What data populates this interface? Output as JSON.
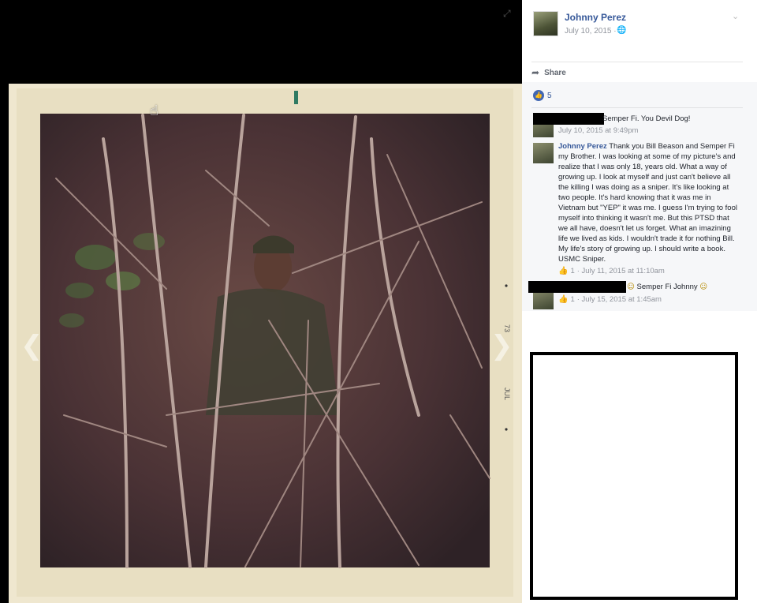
{
  "post": {
    "author": "Johnny Perez",
    "date": "July 10, 2015 ·",
    "globe_icon": "globe-icon",
    "share_label": "Share",
    "likes_count": "5"
  },
  "photo": {
    "edge_text_1": "73",
    "edge_text_2": "JUL"
  },
  "comments": [
    {
      "text": "Semper Fi. You Devil Dog!",
      "meta": "July 10, 2015 at 9:49pm"
    },
    {
      "author": "Johnny Perez",
      "text": "Thank you Bill Beason and Semper Fi my Brother. I was looking at some of my picture's and realize that I was only 18, years old. What a way of growing up. I look at myself and just can't believe all the killing I was doing as a sniper. It's like looking at two people. It's hard knowing that it was me in Vietnam but \"YEP\" it was me. I guess I'm trying to fool myself into thinking it wasn't me. But this PTSD that we all have, doesn't let us forget. What an imazining life we lived as kids. I wouldn't trade it for nothing Bill. My life's story of growing up. I should write a book. USMC Sniper.",
      "like_count": "1",
      "meta": "· July 11, 2015 at 11:10am"
    },
    {
      "text": "Semper Fi Johnny",
      "like_count": "1",
      "meta": "· July 15, 2015 at 1:45am"
    }
  ],
  "colors": {
    "link": "#365899",
    "meta": "#90949c",
    "like_blue": "#4267b2"
  }
}
